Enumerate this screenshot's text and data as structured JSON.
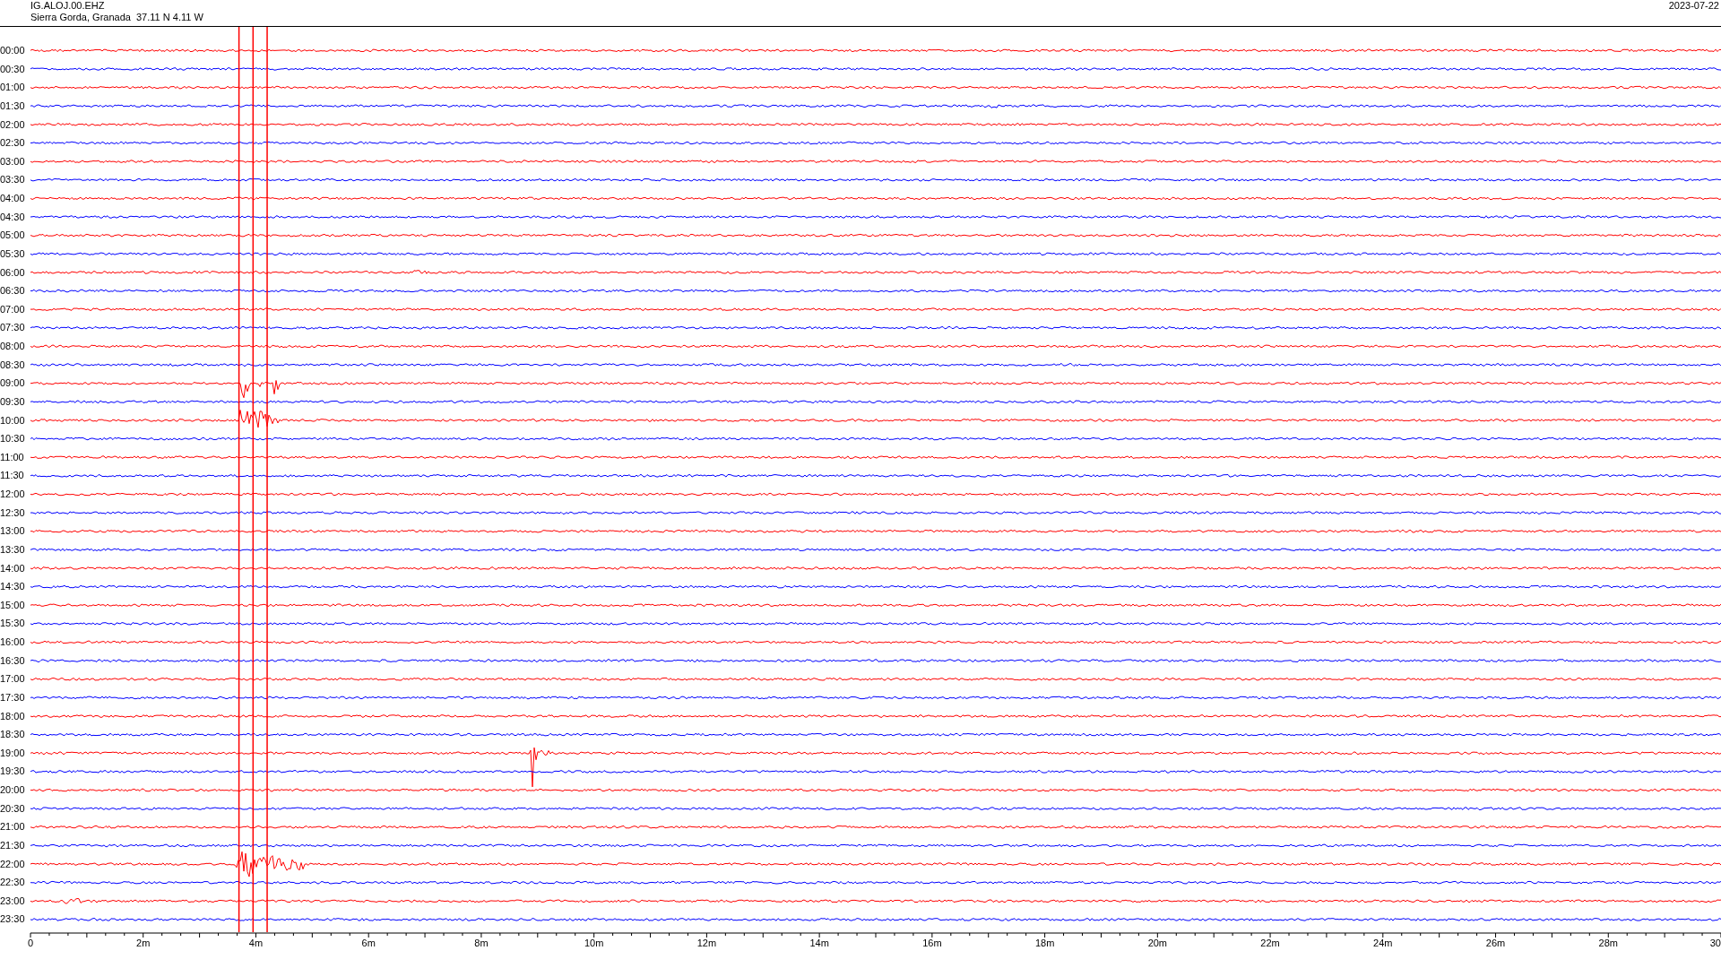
{
  "header": {
    "station": "IG.ALOJ.00.EHZ",
    "location": "Sierra Gorda, Granada  37.11 N 4.11 W",
    "date": "2023-07-22"
  },
  "traces": [
    {
      "time": "00:00",
      "color": "#ff0000"
    },
    {
      "time": "00:30",
      "color": "#0000ff"
    },
    {
      "time": "01:00",
      "color": "#ff0000"
    },
    {
      "time": "01:30",
      "color": "#0000ff"
    },
    {
      "time": "02:00",
      "color": "#ff0000"
    },
    {
      "time": "02:30",
      "color": "#0000ff"
    },
    {
      "time": "03:00",
      "color": "#ff0000"
    },
    {
      "time": "03:30",
      "color": "#0000ff"
    },
    {
      "time": "04:00",
      "color": "#ff0000"
    },
    {
      "time": "04:30",
      "color": "#0000ff"
    },
    {
      "time": "05:00",
      "color": "#ff0000"
    },
    {
      "time": "05:30",
      "color": "#0000ff"
    },
    {
      "time": "06:00",
      "color": "#ff0000"
    },
    {
      "time": "06:30",
      "color": "#0000ff"
    },
    {
      "time": "07:00",
      "color": "#ff0000"
    },
    {
      "time": "07:30",
      "color": "#0000ff"
    },
    {
      "time": "08:00",
      "color": "#ff0000"
    },
    {
      "time": "08:30",
      "color": "#0000ff"
    },
    {
      "time": "09:00",
      "color": "#ff0000"
    },
    {
      "time": "09:30",
      "color": "#0000ff"
    },
    {
      "time": "10:00",
      "color": "#ff0000"
    },
    {
      "time": "10:30",
      "color": "#0000ff"
    },
    {
      "time": "11:00",
      "color": "#ff0000"
    },
    {
      "time": "11:30",
      "color": "#0000ff"
    },
    {
      "time": "12:00",
      "color": "#ff0000"
    },
    {
      "time": "12:30",
      "color": "#0000ff"
    },
    {
      "time": "13:00",
      "color": "#ff0000"
    },
    {
      "time": "13:30",
      "color": "#0000ff"
    },
    {
      "time": "14:00",
      "color": "#ff0000"
    },
    {
      "time": "14:30",
      "color": "#0000ff"
    },
    {
      "time": "15:00",
      "color": "#ff0000"
    },
    {
      "time": "15:30",
      "color": "#0000ff"
    },
    {
      "time": "16:00",
      "color": "#ff0000"
    },
    {
      "time": "16:30",
      "color": "#0000ff"
    },
    {
      "time": "17:00",
      "color": "#ff0000"
    },
    {
      "time": "17:30",
      "color": "#0000ff"
    },
    {
      "time": "18:00",
      "color": "#ff0000"
    },
    {
      "time": "18:30",
      "color": "#0000ff"
    },
    {
      "time": "19:00",
      "color": "#ff0000"
    },
    {
      "time": "19:30",
      "color": "#0000ff"
    },
    {
      "time": "20:00",
      "color": "#ff0000"
    },
    {
      "time": "20:30",
      "color": "#0000ff"
    },
    {
      "time": "21:00",
      "color": "#ff0000"
    },
    {
      "time": "21:30",
      "color": "#0000ff"
    },
    {
      "time": "22:00",
      "color": "#ff0000"
    },
    {
      "time": "22:30",
      "color": "#0000ff"
    },
    {
      "time": "23:00",
      "color": "#ff0000"
    },
    {
      "time": "23:30",
      "color": "#0000ff"
    }
  ],
  "x_axis": {
    "ticks": [
      "0",
      "2m",
      "4m",
      "6m",
      "8m",
      "10m",
      "12m",
      "14m",
      "16m",
      "18m",
      "20m",
      "22m",
      "24m",
      "26m",
      "28m",
      "30"
    ]
  }
}
